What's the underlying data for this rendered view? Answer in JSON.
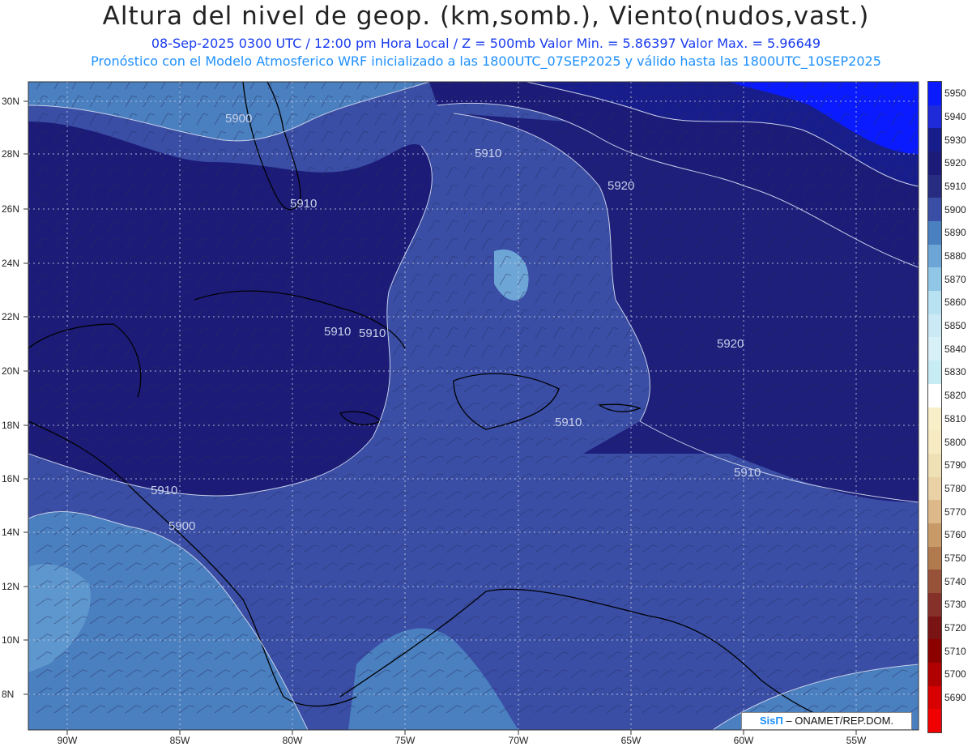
{
  "header": {
    "title": "Altura del nivel de geop. (km,somb.), Viento(nudos,vast.)",
    "line1": "08-Sep-2025  0300 UTC / 12:00 pm Hora Local / Z = 500mb    Valor Min. = 5.86397  Valor Max. = 5.96649",
    "line2": "Pronóstico con el Modelo Atmosferico WRF inicializado a las 1800UTC_07SEP2025 y válido hasta las  1800UTC_10SEP2025"
  },
  "map": {
    "lon_labels": [
      "90W",
      "85W",
      "80W",
      "75W",
      "70W",
      "65W",
      "60W",
      "55W"
    ],
    "lat_labels": [
      "30N",
      "28N",
      "26N",
      "24N",
      "22N",
      "20N",
      "18N",
      "16N",
      "14N",
      "12N",
      "10N",
      "8N"
    ],
    "contour_labels": [
      "5900",
      "5910",
      "5910",
      "5910",
      "5910",
      "5910",
      "5920",
      "5920",
      "5910",
      "5910",
      "5910",
      "5900"
    ]
  },
  "legend": {
    "levels": [
      "5950",
      "5940",
      "5930",
      "5920",
      "5910",
      "5900",
      "5890",
      "5880",
      "5870",
      "5860",
      "5850",
      "5840",
      "5830",
      "5820",
      "5810",
      "5800",
      "5790",
      "5780",
      "5770",
      "5760",
      "5750",
      "5740",
      "5730",
      "5720",
      "5710",
      "5700",
      "5690"
    ],
    "colors": [
      "#0a1cff",
      "#1f2ad8",
      "#181d8c",
      "#1c1b78",
      "#272c80",
      "#3a4ea6",
      "#4a7fc0",
      "#6da6d6",
      "#90c6e6",
      "#b8e1f2",
      "#cbeaf6",
      "#d8f0f8",
      "#c8ecf4",
      "#ffffff",
      "#f8efc8",
      "#f6ebc2",
      "#f0e0b6",
      "#ead2a6",
      "#ddb888",
      "#c89a68",
      "#b07a4e",
      "#98523a",
      "#86302a",
      "#7a1414",
      "#8c0000",
      "#b00000",
      "#d80000",
      "#f00000"
    ]
  },
  "credit": {
    "brand": "SisΠ",
    "text": " – ONAMET/REP.DOM."
  }
}
